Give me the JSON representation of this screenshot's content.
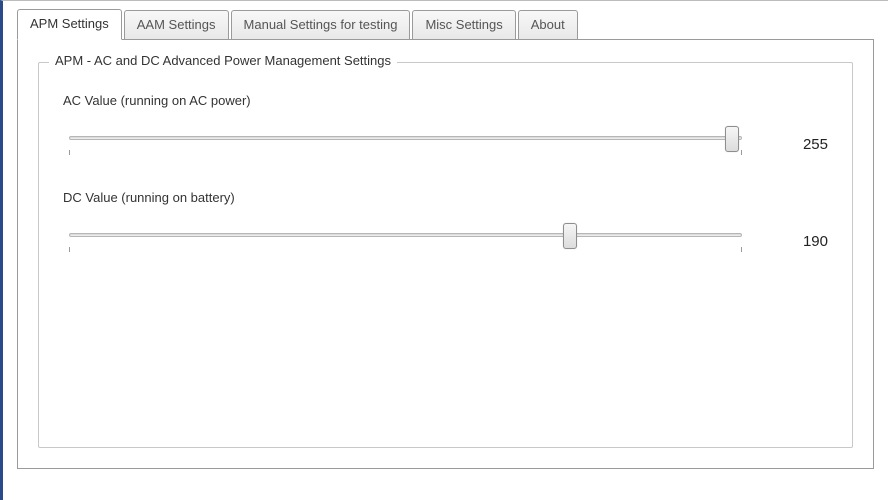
{
  "tabs": [
    {
      "label": "APM Settings",
      "active": true
    },
    {
      "label": "AAM Settings",
      "active": false
    },
    {
      "label": "Manual Settings for testing",
      "active": false
    },
    {
      "label": "Misc Settings",
      "active": false
    },
    {
      "label": "About",
      "active": false
    }
  ],
  "group": {
    "legend": "APM - AC and DC Advanced Power Management Settings",
    "sliders": {
      "ac": {
        "label": "AC Value (running on AC power)",
        "value": "255",
        "min": 0,
        "max": 255,
        "position_pct": 98.5
      },
      "dc": {
        "label": "DC Value (running on battery)",
        "value": "190",
        "min": 0,
        "max": 255,
        "position_pct": 74.5
      }
    }
  }
}
